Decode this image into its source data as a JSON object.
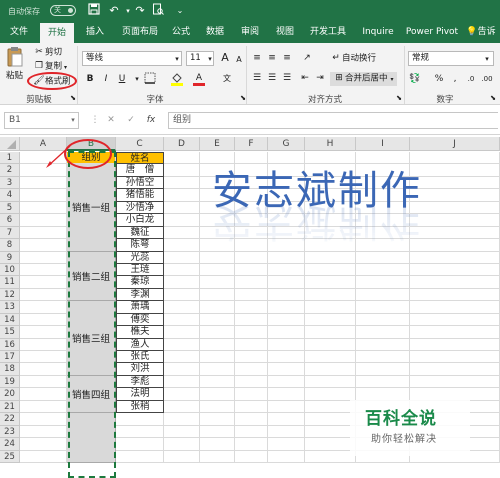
{
  "titlebar": {
    "autosave_label": "自动保存",
    "autosave_state": "关",
    "quick_access": [
      "save-icon",
      "undo-icon",
      "redo-icon",
      "print-preview-icon",
      "customize-icon"
    ]
  },
  "tabs": [
    "文件",
    "开始",
    "插入",
    "页面布局",
    "公式",
    "数据",
    "审阅",
    "视图",
    "开发工具",
    "Inquire",
    "Power Pivot",
    "告诉"
  ],
  "active_tab": "开始",
  "ribbon": {
    "clipboard": {
      "cut": "剪切",
      "copy": "复制",
      "paste": "粘贴",
      "format_painter": "格式刷",
      "label": "剪贴板"
    },
    "font": {
      "name": "等线",
      "size": "11",
      "grow": "A",
      "shrink": "A",
      "bold": "B",
      "italic": "I",
      "underline": "U",
      "color_letter": "A",
      "label": "字体"
    },
    "alignment": {
      "wrap": "自动换行",
      "merge": "合并后居中",
      "label": "对齐方式"
    },
    "number": {
      "format": "常规",
      "label": "数字"
    }
  },
  "formula_bar": {
    "name_box": "B1",
    "fx": "fx",
    "content": "组别"
  },
  "sheet": {
    "columns": [
      "A",
      "B",
      "C",
      "D",
      "E",
      "F",
      "G",
      "H",
      "I",
      "J"
    ],
    "rows": [
      "1",
      "2",
      "3",
      "4",
      "5",
      "6",
      "7",
      "8",
      "9",
      "10",
      "11",
      "12",
      "13",
      "14",
      "15",
      "16",
      "17",
      "18",
      "19",
      "20",
      "21",
      "22",
      "23",
      "24",
      "25"
    ],
    "header_group": "组别",
    "header_name": "姓名",
    "names": [
      "唐　僧",
      "孙悟空",
      "猪悟能",
      "沙悟净",
      "小白龙",
      "魏征",
      "陈萼",
      "光蕊",
      "王琏",
      "秦琼",
      "李渊",
      "萧瑀",
      "傅奕",
      "樵夫",
      "渔人",
      "张氏",
      "刘洪",
      "李彪",
      "法明",
      "张稍"
    ],
    "groups": [
      "销售一组",
      "销售二组",
      "销售三组",
      "销售四组"
    ],
    "big_title": "安志斌制作"
  },
  "watermark": {
    "title": "百科全说",
    "subtitle": "助你轻松解决"
  },
  "colors": {
    "excel_green": "#217346",
    "header_yellow": "#ffc000",
    "annotation_red": "#e0252a",
    "title_blue": "#3b67b5"
  }
}
